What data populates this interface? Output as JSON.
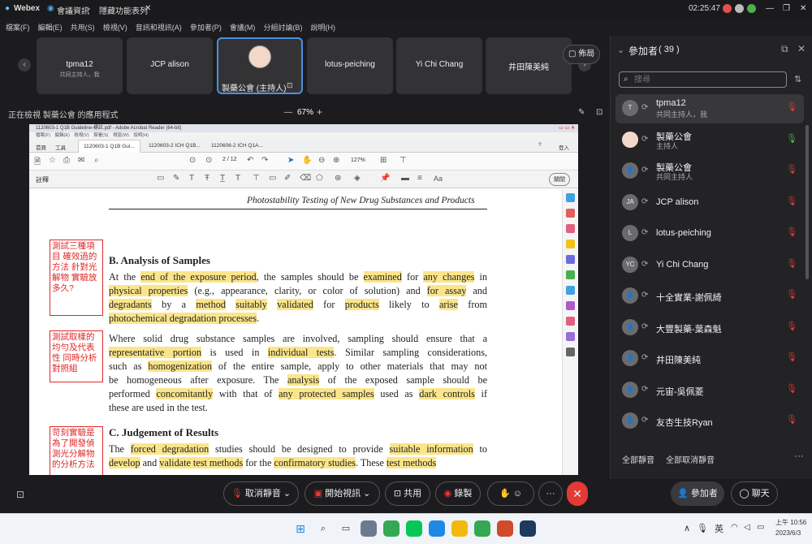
{
  "app": {
    "name": "Webex",
    "mode": "會議資訊",
    "hidden": "隱藏功能表列",
    "clock": "02:25:47"
  },
  "menu": [
    "檔案(F)",
    "編輯(E)",
    "共用(S)",
    "檢視(V)",
    "音訊和視訊(A)",
    "參加者(P)",
    "會議(M)",
    "分組討論(B)",
    "說明(H)"
  ],
  "tiles": [
    {
      "name": "tpma12",
      "sub": "共同主持人，我"
    },
    {
      "name": "JCP alison",
      "sub": ""
    },
    {
      "name": "製藥公會 (主持人)",
      "sub": ""
    },
    {
      "name": "lotus-peiching",
      "sub": ""
    },
    {
      "name": "Yi Chi Chang",
      "sub": ""
    },
    {
      "name": "井田陳美純",
      "sub": ""
    }
  ],
  "layout_btn": "佈局",
  "share": {
    "text": "正在檢視 製藥公會 的應用程式",
    "zoom": "67%",
    "minus": "—",
    "plus": "+"
  },
  "acrobat": {
    "title": "1120603-1 Q1B Guideline-標註.pdf - Adobe Acrobat Reader (64-bit)",
    "menu": "檔案(F)　編輯(E)　檢視(V)　簽署(S)　視窗(W)　說明(H)",
    "tabs": [
      "首頁",
      "工具",
      "1120603-1 Q1B Gui...",
      "1120603-2 ICH Q1B...",
      "1120606-2 ICH Q1A..."
    ],
    "signin": "登入",
    "page": "2 / 12",
    "zoomlevel": "127%",
    "annot_label": "註釋",
    "close_btn": "關閉"
  },
  "doc": {
    "header": "Photostability Testing of New Drug Substances and Products",
    "secB": "B.  Analysis of Samples",
    "secC": "C.  Judgement of Results",
    "para1": [
      [
        [
          "At the ",
          0
        ],
        [
          "end of the exposure period",
          1
        ],
        [
          ", the samples should be ",
          0
        ],
        [
          "examined",
          1
        ],
        [
          " for ",
          0
        ],
        [
          "any changes",
          1
        ],
        [
          " in",
          0
        ]
      ],
      [
        [
          "physical properties",
          1
        ],
        [
          " (e.g., appearance, clarity, or color of solution) and ",
          0
        ],
        [
          "for assay",
          1
        ],
        [
          " and",
          0
        ]
      ],
      [
        [
          "degradants",
          1
        ],
        [
          " by a ",
          0
        ],
        [
          "method",
          1
        ],
        [
          " ",
          0
        ],
        [
          "suitably",
          1
        ],
        [
          " ",
          0
        ],
        [
          "validated",
          1
        ],
        [
          " for ",
          0
        ],
        [
          "products",
          1
        ],
        [
          " likely to ",
          0
        ],
        [
          "arise",
          1
        ],
        [
          " from",
          0
        ]
      ],
      [
        [
          "photochemical degradation processes",
          1
        ],
        [
          ".",
          0
        ]
      ]
    ],
    "para2": [
      [
        [
          "Where solid drug substance samples are involved, sampling should ensure that a",
          0
        ]
      ],
      [
        [
          "representative portion",
          1
        ],
        [
          " is used in ",
          0
        ],
        [
          "individual tests",
          1
        ],
        [
          ".  Similar sampling considerations,",
          0
        ]
      ],
      [
        [
          "such as ",
          0
        ],
        [
          "homogenization",
          1
        ],
        [
          " of the entire sample, apply to other materials that may not",
          0
        ]
      ],
      [
        [
          "be homogeneous after exposure.  The ",
          0
        ],
        [
          "analysis",
          1
        ],
        [
          " of the exposed sample should be",
          0
        ]
      ],
      [
        [
          "performed ",
          0
        ],
        [
          "concomitantly",
          1
        ],
        [
          " with that of ",
          0
        ],
        [
          "any protected samples",
          1
        ],
        [
          " used as ",
          0
        ],
        [
          "dark controls",
          1
        ],
        [
          " if",
          0
        ]
      ],
      [
        [
          "these are used in the test.",
          0
        ]
      ]
    ],
    "para3": [
      [
        [
          "The ",
          0
        ],
        [
          "forced degradation",
          1
        ],
        [
          " studies should be designed to provide ",
          0
        ],
        [
          "suitable information",
          1
        ],
        [
          " to",
          0
        ]
      ],
      [
        [
          "develop",
          1
        ],
        [
          " and ",
          0
        ],
        [
          "validate test methods",
          1
        ],
        [
          " for the ",
          0
        ],
        [
          "confirmatory studies",
          1
        ],
        [
          ".  These ",
          0
        ],
        [
          "test methods",
          1
        ]
      ]
    ],
    "notes": [
      "測試三種項目 確效過的方法 針對光解物 實驗放多久?",
      "測試取樣的均勻及代表性 同時分析對照組",
      "苛刻實驗是為了開發偵測光分解物的分析方法"
    ]
  },
  "panel": {
    "title": "參加者",
    "count": "( 39 )",
    "search_placeholder": "搜尋",
    "people": [
      {
        "init": "T",
        "n1": "tpma12",
        "n2": "共同主持人，我",
        "mic": "muted"
      },
      {
        "init": "",
        "n1": "製藥公會",
        "n2": "主持人",
        "mic": "on"
      },
      {
        "init": "",
        "n1": "製藥公會",
        "n2": "共同主持人",
        "mic": "muted"
      },
      {
        "init": "JA",
        "n1": "JCP alison",
        "n2": "",
        "mic": "muted"
      },
      {
        "init": "L",
        "n1": "lotus-peiching",
        "n2": "",
        "mic": "muted"
      },
      {
        "init": "YC",
        "n1": "Yi Chi Chang",
        "n2": "",
        "mic": "muted"
      },
      {
        "init": "",
        "n1": "十全實業-謝佩綺",
        "n2": "",
        "mic": "muted"
      },
      {
        "init": "",
        "n1": "大豐製藥-葉森魁",
        "n2": "",
        "mic": "muted"
      },
      {
        "init": "",
        "n1": "井田陳美純",
        "n2": "",
        "mic": "muted"
      },
      {
        "init": "",
        "n1": "元宙-吳佩菱",
        "n2": "",
        "mic": "muted"
      },
      {
        "init": "",
        "n1": "友杏生技Ryan",
        "n2": "",
        "mic": "muted"
      }
    ],
    "mute_all": "全部靜音",
    "unmute_all": "全部取消靜音"
  },
  "controls": {
    "mute": "取消靜音",
    "video": "開始視訊",
    "share": "共用",
    "record": "錄製",
    "participants": "參加者",
    "chat": "聊天"
  },
  "taskbar": {
    "ime": "英",
    "time": "上午 10:56",
    "date": "2023/6/3"
  },
  "colors": {
    "highlight": "#fbe58a",
    "note_red": "#e02828",
    "end_red": "#e53935",
    "active_blue": "#4a90e2"
  }
}
